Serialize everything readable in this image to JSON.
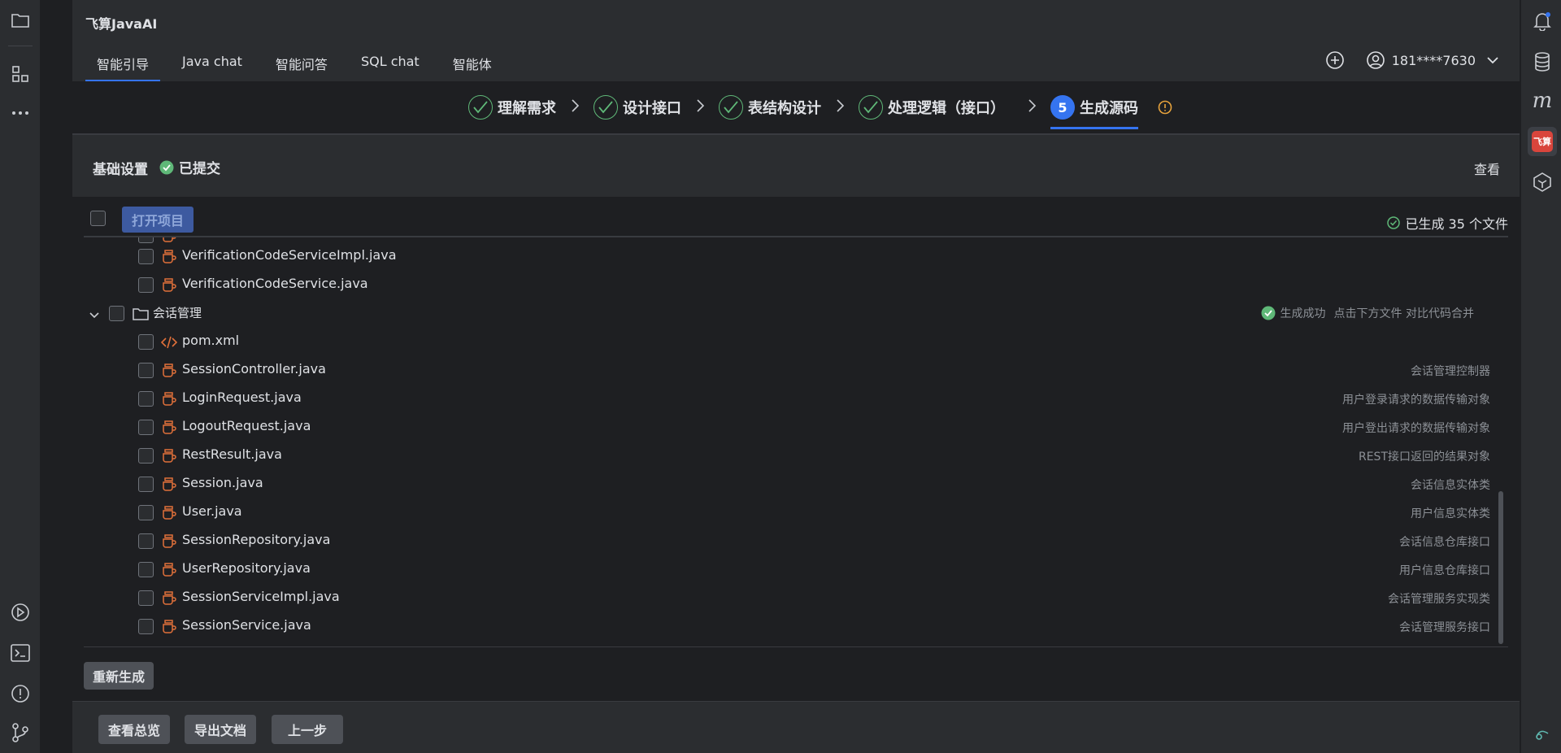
{
  "app": {
    "title": "飞算JavaAI"
  },
  "tabs": [
    {
      "label": "智能引导",
      "active": true
    },
    {
      "label": "Java chat"
    },
    {
      "label": "智能问答"
    },
    {
      "label": "SQL chat"
    },
    {
      "label": "智能体"
    }
  ],
  "user": {
    "name": "181****7630"
  },
  "steps": [
    {
      "label": "理解需求",
      "state": "done"
    },
    {
      "label": "设计接口",
      "state": "done"
    },
    {
      "label": "表结构设计",
      "state": "done"
    },
    {
      "label": "处理逻辑（接口）",
      "state": "done"
    },
    {
      "number": "5",
      "label": "生成源码",
      "state": "current"
    }
  ],
  "basic": {
    "title": "基础设置",
    "status": "已提交",
    "view": "查看"
  },
  "list": {
    "open_project": "打开项目",
    "generated_count": "已生成 35 个文件",
    "rows": [
      {
        "name": "VerificationCodeServiceImpl.java",
        "desc": ""
      },
      {
        "name": "VerificationCodeService.java",
        "desc": ""
      }
    ],
    "group": {
      "name": "会话管理",
      "status": "生成成功",
      "hint": "点击下方文件 对比代码合并",
      "files": [
        {
          "name": "pom.xml",
          "type": "xml",
          "desc": ""
        },
        {
          "name": "SessionController.java",
          "type": "java",
          "desc": "会话管理控制器"
        },
        {
          "name": "LoginRequest.java",
          "type": "java",
          "desc": "用户登录请求的数据传输对象"
        },
        {
          "name": "LogoutRequest.java",
          "type": "java",
          "desc": "用户登出请求的数据传输对象"
        },
        {
          "name": "RestResult.java",
          "type": "java",
          "desc": "REST接口返回的结果对象"
        },
        {
          "name": "Session.java",
          "type": "java",
          "desc": "会话信息实体类"
        },
        {
          "name": "User.java",
          "type": "java",
          "desc": "用户信息实体类"
        },
        {
          "name": "SessionRepository.java",
          "type": "java",
          "desc": "会话信息仓库接口"
        },
        {
          "name": "UserRepository.java",
          "type": "java",
          "desc": "用户信息仓库接口"
        },
        {
          "name": "SessionServiceImpl.java",
          "type": "java",
          "desc": "会话管理服务实现类"
        },
        {
          "name": "SessionService.java",
          "type": "java",
          "desc": "会话管理服务接口"
        }
      ]
    },
    "regenerate": "重新生成"
  },
  "footer": {
    "overview": "查看总览",
    "export": "导出文档",
    "prev": "上一步"
  },
  "colors": {
    "accent": "#3574f0",
    "success": "#5fb878",
    "java_icon": "#e0703a",
    "warning": "#e6a23c"
  },
  "icons": {
    "left": [
      "folder-icon",
      "structure-icon",
      "more-icon",
      "run-icon",
      "terminal-icon",
      "problems-icon",
      "git-icon"
    ],
    "right": [
      "notifications-icon",
      "database-icon",
      "maven-icon",
      "feisuan-icon",
      "ai-assistant-icon"
    ]
  }
}
